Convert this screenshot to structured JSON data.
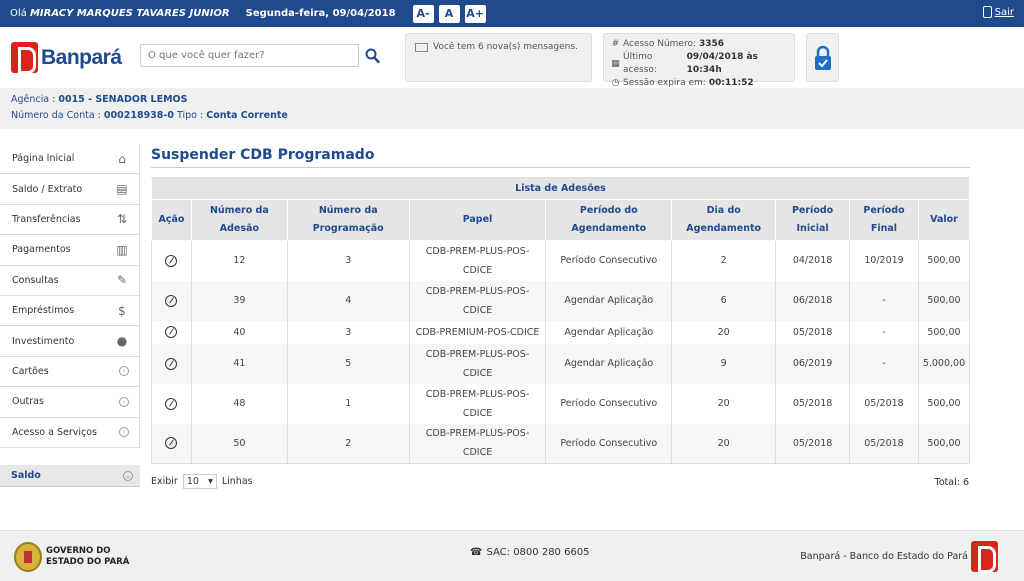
{
  "topbar": {
    "greeting_prefix": "Olá",
    "user_name": "MIRACY MARQUES TAVARES JUNIOR",
    "date": "Segunda-feira, 09/04/2018",
    "font_buttons": [
      "A-",
      "A",
      "A+"
    ],
    "exit_label": "Sair"
  },
  "header": {
    "logo_text": "Banpará",
    "search_placeholder": "O que você quer fazer?",
    "messages": "Você tem 6 nova(s) mensagens.",
    "access_number_label": "Acesso Número:",
    "access_number": "3356",
    "last_access_label": "Último acesso:",
    "last_access": "09/04/2018 às 10:34h",
    "session_label": "Sessão expira em:",
    "session_time": "00:11:52"
  },
  "account": {
    "agency_label": "Agência :",
    "agency": "0015 - SENADOR LEMOS",
    "account_label": "Número da Conta :",
    "account_number": "000218938-0",
    "type_label": "Tipo :",
    "type": "Conta Corrente"
  },
  "sidebar": {
    "items": [
      {
        "label": "Página Inicial",
        "icon": "home-icon"
      },
      {
        "label": "Saldo / Extrato",
        "icon": "statement-icon"
      },
      {
        "label": "Transferências",
        "icon": "transfer-icon"
      },
      {
        "label": "Pagamentos",
        "icon": "barcode-icon"
      },
      {
        "label": "Consultas",
        "icon": "query-icon"
      },
      {
        "label": "Empréstimos",
        "icon": "loan-icon"
      },
      {
        "label": "Investimento",
        "icon": "piggy-bank-icon"
      },
      {
        "label": "Cartões",
        "icon": "chevron-right-icon"
      },
      {
        "label": "Outras",
        "icon": "chevron-right-icon"
      },
      {
        "label": "Acesso a Serviços",
        "icon": "chevron-right-icon"
      }
    ],
    "saldo_label": "Saldo"
  },
  "main": {
    "title": "Suspender CDB Programado",
    "table_caption": "Lista de Adesões",
    "headers": {
      "acao": "Ação",
      "adesao": [
        "Número da",
        "Adesão"
      ],
      "programacao": [
        "Número da",
        "Programação"
      ],
      "papel": "Papel",
      "periodo_agend": [
        "Período do",
        "Agendamento"
      ],
      "dia": [
        "Dia do",
        "Agendamento"
      ],
      "periodo_ini": [
        "Período",
        "Inicial"
      ],
      "periodo_fim": [
        "Período",
        "Final"
      ],
      "valor": "Valor"
    },
    "rows": [
      {
        "adesao": "12",
        "prog": "3",
        "papel": [
          "CDB-PREM-PLUS-POS-",
          "CDICE"
        ],
        "periodo": "Período Consecutivo",
        "dia": "2",
        "ini": "04/2018",
        "fim": "10/2019",
        "valor": "500,00"
      },
      {
        "adesao": "39",
        "prog": "4",
        "papel": [
          "CDB-PREM-PLUS-POS-",
          "CDICE"
        ],
        "periodo": "Agendar Aplicação",
        "dia": "6",
        "ini": "06/2018",
        "fim": "-",
        "valor": "500,00"
      },
      {
        "adesao": "40",
        "prog": "3",
        "papel": [
          "CDB-PREMIUM-POS-CDICE"
        ],
        "periodo": "Agendar Aplicação",
        "dia": "20",
        "ini": "05/2018",
        "fim": "-",
        "valor": "500,00"
      },
      {
        "adesao": "41",
        "prog": "5",
        "papel": [
          "CDB-PREM-PLUS-POS-",
          "CDICE"
        ],
        "periodo": "Agendar Aplicação",
        "dia": "9",
        "ini": "06/2019",
        "fim": "-",
        "valor": "5.000,00"
      },
      {
        "adesao": "48",
        "prog": "1",
        "papel": [
          "CDB-PREM-PLUS-POS-",
          "CDICE"
        ],
        "periodo": "Período Consecutivo",
        "dia": "20",
        "ini": "05/2018",
        "fim": "05/2018",
        "valor": "500,00"
      },
      {
        "adesao": "50",
        "prog": "2",
        "papel": [
          "CDB-PREM-PLUS-POS-",
          "CDICE"
        ],
        "periodo": "Período Consecutivo",
        "dia": "20",
        "ini": "05/2018",
        "fim": "05/2018",
        "valor": "500,00"
      }
    ],
    "show_label": "Exibir",
    "show_value": "10",
    "lines_label": "Linhas",
    "total_label": "Total:",
    "total_value": "6"
  },
  "footer": {
    "gov_line1": "GOVERNO DO",
    "gov_line2": "ESTADO DO PARÁ",
    "sac": "SAC: 0800 280 6605",
    "bank_name": "Banpará - Banco do Estado do Pará"
  }
}
